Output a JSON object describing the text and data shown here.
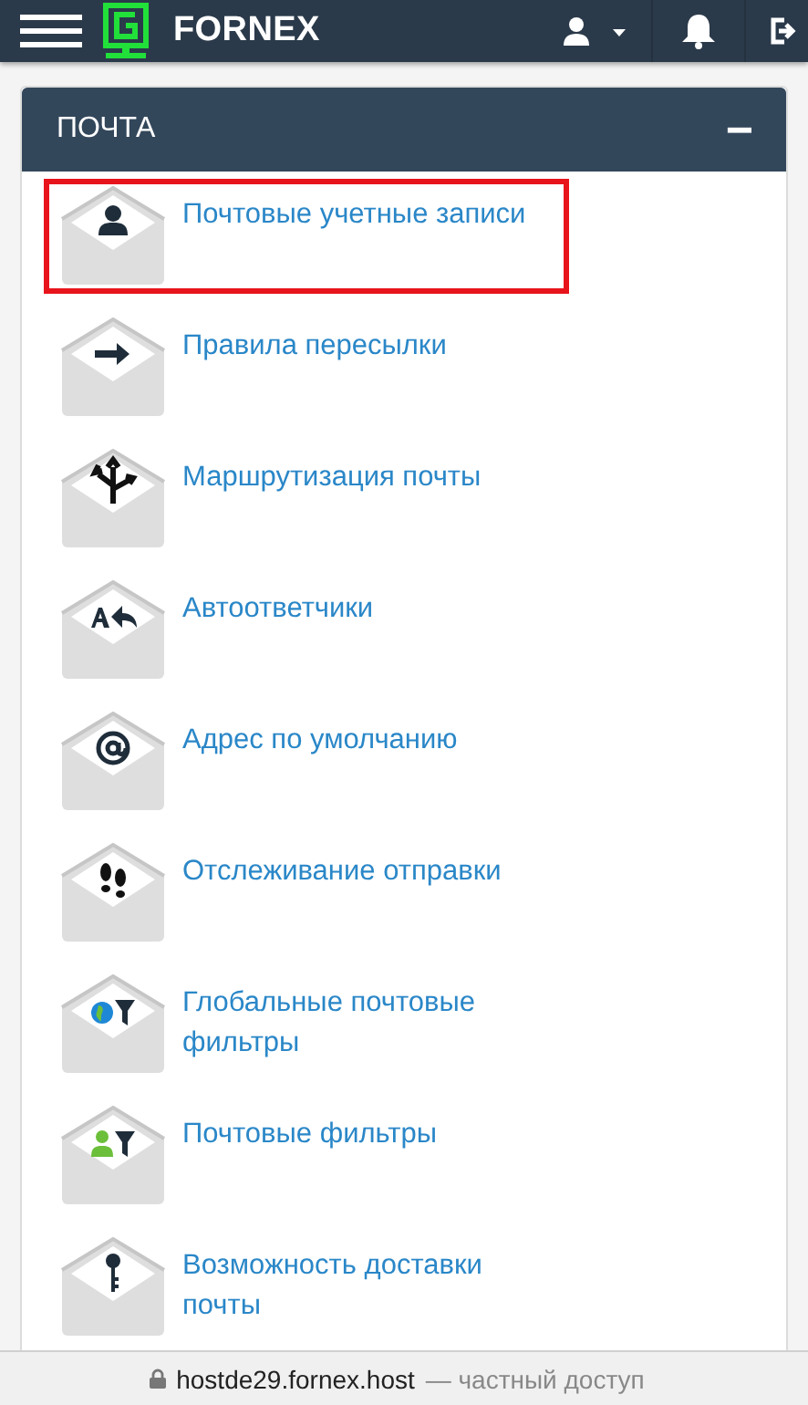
{
  "navbar": {
    "brand": "FORNEX"
  },
  "panel": {
    "title": "ПОЧТА",
    "collapse_symbol": "−"
  },
  "items": [
    {
      "label": "Почтовые учетные записи",
      "kind": "accounts",
      "selected": true
    },
    {
      "label": "Правила пересылки",
      "kind": "forward",
      "selected": false
    },
    {
      "label": "Маршрутизация почты",
      "kind": "routing",
      "selected": false
    },
    {
      "label": "Автоответчики",
      "kind": "autoreply",
      "selected": false
    },
    {
      "label": "Адрес по умолчанию",
      "kind": "default",
      "selected": false
    },
    {
      "label": "Отслеживание отправки",
      "kind": "tracking",
      "selected": false
    },
    {
      "label": "Глобальные почтовые фильтры",
      "kind": "global_filter",
      "selected": false
    },
    {
      "label": "Почтовые фильтры",
      "kind": "user_filter",
      "selected": false
    },
    {
      "label": "Возможность доставки почты",
      "kind": "delivery",
      "selected": false
    }
  ],
  "address_bar": {
    "host": "hostde29.fornex.host",
    "note": "— частный доступ"
  }
}
